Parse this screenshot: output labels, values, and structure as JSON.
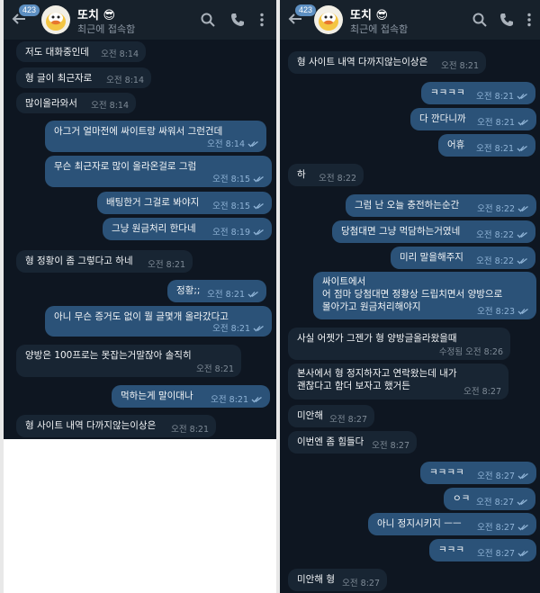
{
  "header": {
    "unread_badge": "423",
    "title": "또치",
    "status": "최근에 접속함",
    "avatar_label": "또치"
  },
  "left_messages": [
    {
      "text": "저도 대화중인데",
      "time": "오전 8:14"
    },
    {
      "text": "형 글이 최근자로",
      "time": "오전 8:14"
    },
    {
      "text": "많이올라와서",
      "time": "오전 8:14"
    },
    {
      "text": "아그거 얼마전에 싸이트랑 싸워서 그런건데",
      "time": "오전 8:14"
    },
    {
      "text": "무슨 최근자로 많이 올라온걸로 그럼",
      "time": "오전 8:15"
    },
    {
      "text": "배팅한거 그걸로 봐야지",
      "time": "오전 8:15"
    },
    {
      "text": "그냥 원금처리 한다네",
      "time": "오전 8:19"
    },
    {
      "text": "형 정황이 좀 그렇다고 하네",
      "time": "오전 8:21"
    },
    {
      "text": "정황;;",
      "time": "오전 8:21"
    },
    {
      "text": "아니 무슨 증거도 없이 뭘 글몇개 올라갔다고",
      "time": "오전 8:21"
    },
    {
      "text": "양방은 100프로는 못잡는거말잖아 솔직히",
      "time": "오전 8:21"
    },
    {
      "text": "먹하는게 말이대나",
      "time": "오전 8:21"
    },
    {
      "text": "형 사이트 내역 다까지않는이상은",
      "time": "오전 8:21"
    }
  ],
  "right_messages": [
    {
      "text": "형 사이트 내역 다까지않는이상은",
      "time": "오전 8:21"
    },
    {
      "text": "ㅋㅋㅋㅋ",
      "time": "오전 8:21"
    },
    {
      "text": "다 깐다니까",
      "time": "오전 8:21"
    },
    {
      "text": "어휴",
      "time": "오전 8:21"
    },
    {
      "text": "하",
      "time": "오전 8:22"
    },
    {
      "text": "그럼 난 오늘 충전하는순간",
      "time": "오전 8:22"
    },
    {
      "text": "당첨대면 그냥 먹담하는거였네",
      "time": "오전 8:22"
    },
    {
      "text": "미리 말을해주지",
      "time": "오전 8:22"
    },
    {
      "lines": [
        "싸이트에서",
        "어 점마 당첨대면 정황상 드립치면서 양방으로",
        "몰아가고 원금처리해야지"
      ],
      "time": "오전 8:23"
    },
    {
      "text": "사실 어젯가 그젠가 형 양방글올라왔을때",
      "time": "수정됨 오전 8:26"
    },
    {
      "lines": [
        "본사에서 형 정지하자고 연락왔는데 내가",
        "괜찮다고 함더 보자고 했거든"
      ],
      "time": "오전 8:27"
    },
    {
      "text": "미안해",
      "time": "오전 8:27"
    },
    {
      "text": "이번엔 좀 힘들다",
      "time": "오전 8:27"
    },
    {
      "text": "ㅋㅋㅋㅋ",
      "time": "오전 8:27"
    },
    {
      "text": "ㅇㅋ",
      "time": "오전 8:27"
    },
    {
      "text": "아니 정지시키지 ㅡㅡ",
      "time": "오전 8:27"
    },
    {
      "text": "ㅋㅋㅋ",
      "time": "오전 8:27"
    },
    {
      "text": "미안해 형",
      "time": "오전 8:27"
    }
  ],
  "colors": {
    "background": "#0e1621",
    "header": "#17212b",
    "incoming_bubble": "#182533",
    "outgoing_bubble": "#2b5278",
    "read_tick": "#8fb3d6",
    "badge": "#5d8fc2"
  },
  "icons": [
    "back-arrow-icon",
    "search-icon",
    "phone-icon",
    "more-vertical-icon",
    "double-check-icon"
  ]
}
